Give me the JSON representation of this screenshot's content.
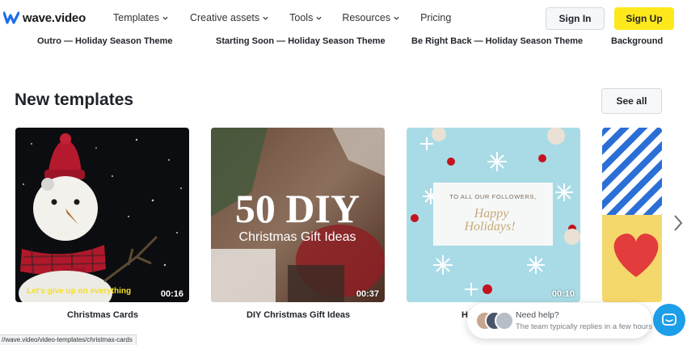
{
  "header": {
    "logo_text": "wave.video",
    "nav": [
      {
        "label": "Templates",
        "has_dropdown": true
      },
      {
        "label": "Creative assets",
        "has_dropdown": true
      },
      {
        "label": "Tools",
        "has_dropdown": true
      },
      {
        "label": "Resources",
        "has_dropdown": true
      },
      {
        "label": "Pricing",
        "has_dropdown": false
      }
    ],
    "sign_in": "Sign In",
    "sign_up": "Sign Up"
  },
  "top_row": {
    "captions": [
      "Outro — Holiday Season Theme",
      "Starting Soon — Holiday Season Theme",
      "Be Right Back — Holiday Season Theme",
      "Background"
    ]
  },
  "new_templates": {
    "title": "New templates",
    "see_all": "See all",
    "cards": [
      {
        "caption": "Christmas Cards",
        "duration": "00:16",
        "overlay_text": "Let's give up on everything"
      },
      {
        "caption": "DIY Christmas Gift Ideas",
        "duration": "00:37",
        "overlay_big": "50 DIY",
        "overlay_small": "Christmas Gift Ideas"
      },
      {
        "caption": "H",
        "duration": "00:10",
        "overlay_top": "TO ALL OUR FOLLOWERS,",
        "overlay_main_1": "Happy",
        "overlay_main_2": "Holidays!"
      },
      {
        "caption": "",
        "duration": ""
      }
    ]
  },
  "status_bar": {
    "url": "//wave.video/video-templates/christmas-cards"
  },
  "help_widget": {
    "title": "Need help?",
    "subtitle": "The team typically replies in a few hours"
  },
  "colors": {
    "signup_yellow": "#fde81c",
    "chat_blue": "#1d9ee8",
    "logo_blue": "#1e6ee8"
  }
}
